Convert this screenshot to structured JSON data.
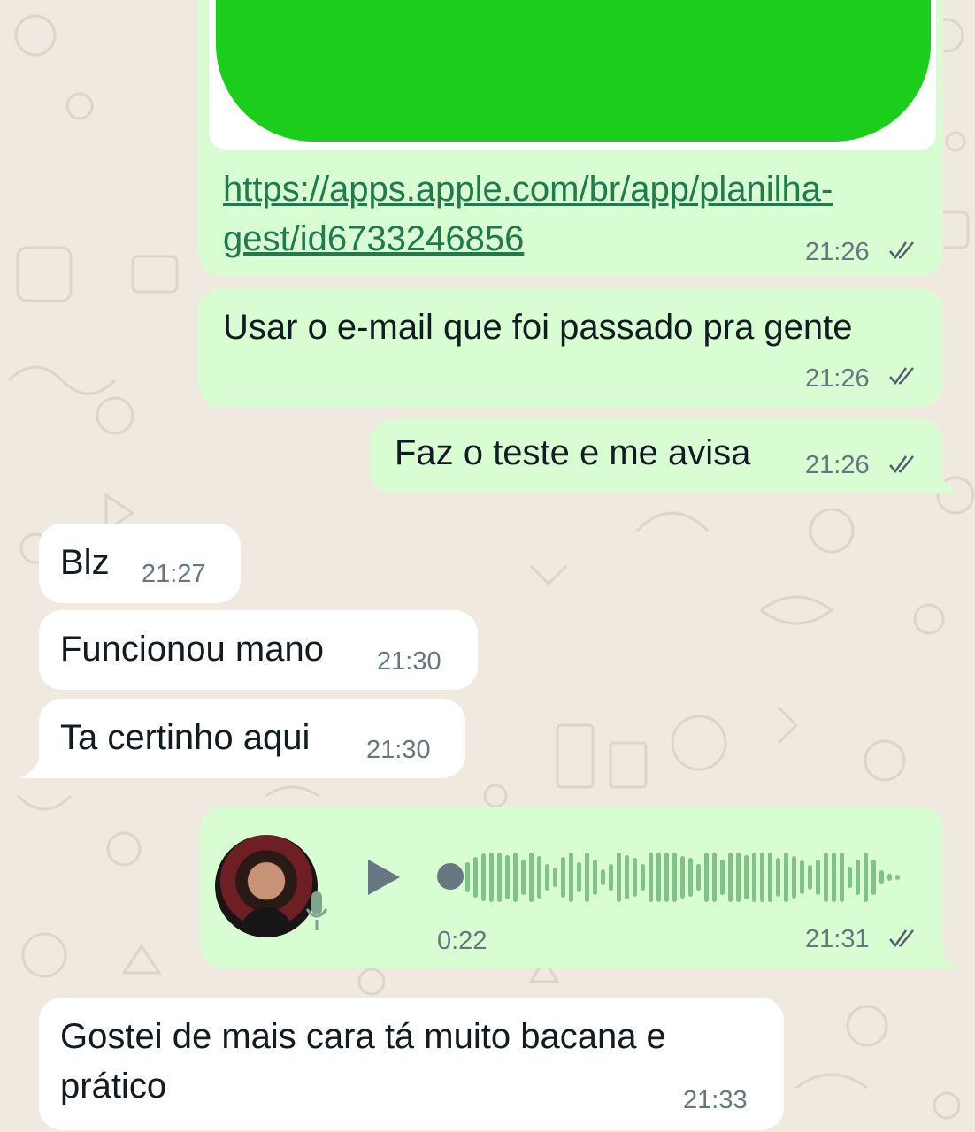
{
  "colors": {
    "outgoing_bubble": "#d9fdd3",
    "incoming_bubble": "#ffffff",
    "chat_background": "#efe9e0",
    "link": "#1f7a4d",
    "timestamp": "#667781",
    "read_ticks": "#53606a",
    "link_preview_image": "#1bce1b",
    "audio_wave": "#82c28a"
  },
  "messages": [
    {
      "direction": "outgoing",
      "type": "link",
      "link_line1": "https://apps.apple.com/br/app/planilha-",
      "link_line2": "gest/id6733246856",
      "time": "21:26",
      "status_icon": "double-check-icon"
    },
    {
      "direction": "outgoing",
      "type": "text",
      "text": "Usar o e-mail que foi passado pra gente",
      "time": "21:26",
      "status_icon": "double-check-icon"
    },
    {
      "direction": "outgoing",
      "type": "text",
      "text": "Faz o teste e me avisa",
      "time": "21:26",
      "status_icon": "double-check-icon"
    },
    {
      "direction": "incoming",
      "type": "text",
      "text": "Blz",
      "time": "21:27"
    },
    {
      "direction": "incoming",
      "type": "text",
      "text": "Funcionou mano",
      "time": "21:30"
    },
    {
      "direction": "incoming",
      "type": "text",
      "text": "Ta certinho aqui",
      "time": "21:30"
    },
    {
      "direction": "outgoing",
      "type": "audio",
      "duration": "0:22",
      "played_fraction": 0.0,
      "time": "21:31",
      "status_icon": "double-check-icon",
      "avatar_icon": "sender-avatar-photo",
      "mic_icon": "microphone-icon",
      "play_icon": "play-icon"
    },
    {
      "direction": "incoming",
      "type": "text",
      "text_line1": "Gostei de mais cara tá muito bacana e",
      "text_line2": "prático",
      "time": "21:33"
    }
  ]
}
